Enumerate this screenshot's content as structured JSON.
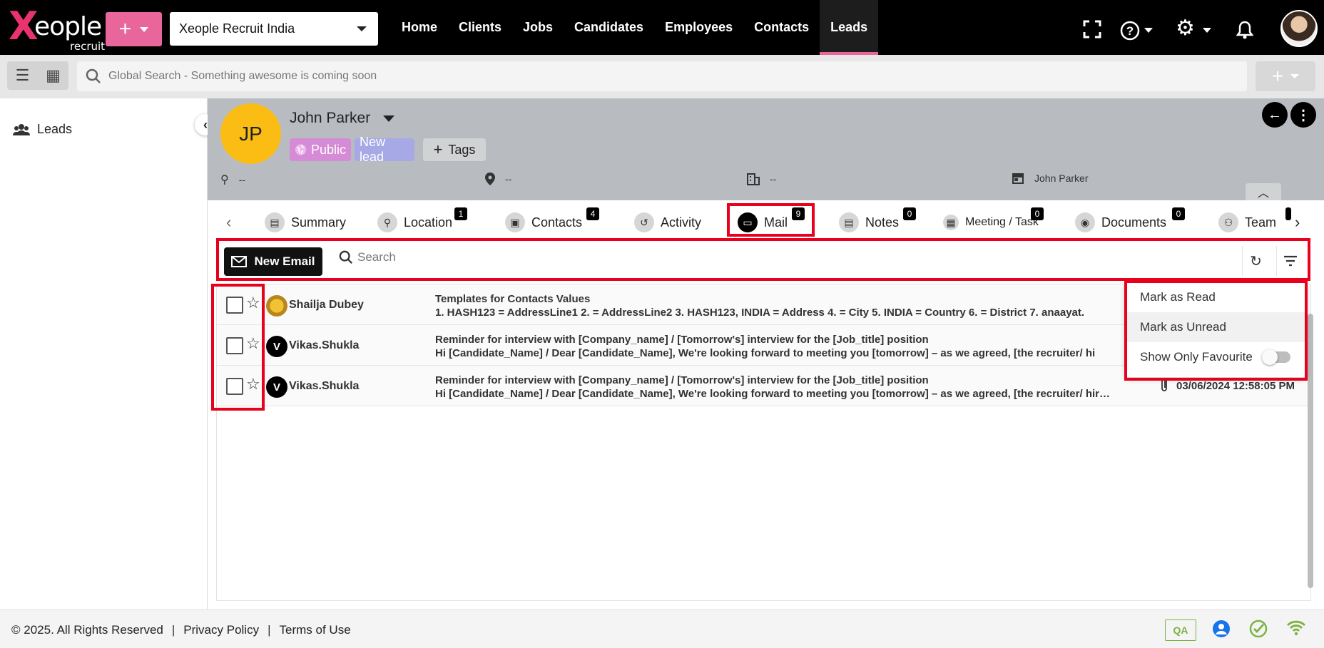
{
  "brand": {
    "logo_mark": "X",
    "logo_text": "eople",
    "logo_sub": "recruit"
  },
  "header": {
    "add_label": "+",
    "company": "Xeople Recruit India",
    "nav": [
      "Home",
      "Clients",
      "Jobs",
      "Candidates",
      "Employees",
      "Contacts",
      "Leads"
    ],
    "active_nav": "Leads",
    "icons": [
      "fullscreen-icon",
      "help-icon",
      "settings-icon",
      "bell-icon"
    ]
  },
  "search": {
    "placeholder": "Global Search - Something awesome is coming soon"
  },
  "secondbar": {
    "add_label": "+"
  },
  "sidebar": {
    "items": [
      {
        "label": "Leads",
        "icon": "users-icon"
      }
    ]
  },
  "lead": {
    "initials": "JP",
    "name": "John Parker",
    "chips": {
      "public": "Public",
      "new_lead": "New lead"
    },
    "tags_label": "Tags",
    "meta": {
      "source": "--",
      "location": "--",
      "company": "--",
      "owner": "John Parker"
    }
  },
  "tabs": [
    {
      "label": "Summary",
      "badge": ""
    },
    {
      "label": "Location",
      "badge": "1"
    },
    {
      "label": "Contacts",
      "badge": "4"
    },
    {
      "label": "Activity",
      "badge": ""
    },
    {
      "label": "Mail",
      "badge": "9"
    },
    {
      "label": "Notes",
      "badge": "0"
    },
    {
      "label": "Meeting / Task",
      "badge": "0"
    },
    {
      "label": "Documents",
      "badge": "0"
    },
    {
      "label": "Team",
      "badge": ""
    }
  ],
  "mail_toolbar": {
    "new_email_label": "New Email",
    "search_placeholder": "Search"
  },
  "mails": [
    {
      "sender": "Shailja Dubey",
      "avatar": "",
      "subject": "Templates for Contacts Values",
      "preview": "1. HASH123 = AddressLine1 2. = AddressLine2 3. HASH123, INDIA = Address 4. = City 5. INDIA = Country 6. = District 7. anaayat.",
      "date": ""
    },
    {
      "sender": "Vikas.Shukla",
      "avatar": "V",
      "subject": "Reminder for interview with [Company_name] / [Tomorrow's] interview for the [Job_title] position",
      "preview": "Hi [Candidate_Name] / Dear [Candidate_Name], We're looking forward to meeting you [tomorrow] – as we agreed, [the recruiter/ hi",
      "date": ""
    },
    {
      "sender": "Vikas.Shukla",
      "avatar": "V",
      "subject": "Reminder for interview with [Company_name] / [Tomorrow's] interview for the [Job_title] position",
      "preview": "Hi [Candidate_Name] / Dear [Candidate_Name], We're looking forward to meeting you [tomorrow] – as we agreed, [the recruiter/ hir…",
      "date": "03/06/2024 12:58:05 PM"
    }
  ],
  "filter_menu": {
    "mark_read": "Mark as Read",
    "mark_unread": "Mark as Unread",
    "show_fav": "Show Only Favourite",
    "show_fav_on": false
  },
  "footer": {
    "copyright": "© 2025. All Rights Reserved",
    "sep": "|",
    "privacy": "Privacy Policy",
    "terms": "Terms of Use",
    "qa": "QA"
  },
  "colors": {
    "accent": "#e8669b",
    "highlight": "#e8001c",
    "avatar": "#fbbd14"
  }
}
